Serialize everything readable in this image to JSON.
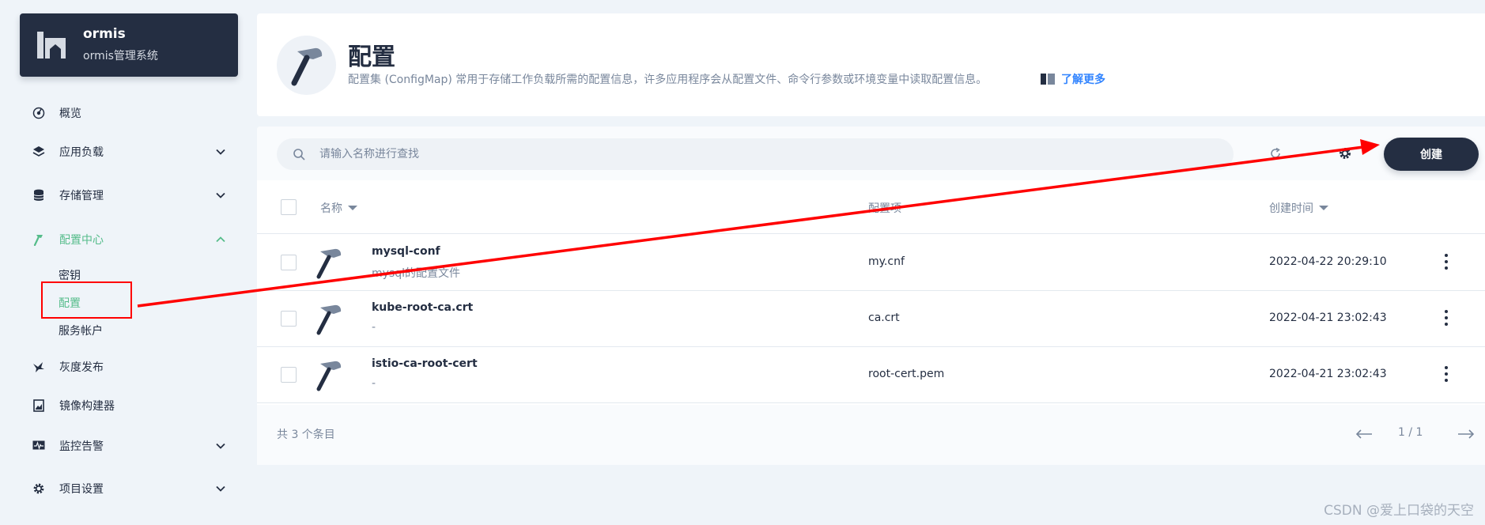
{
  "project": {
    "name": "ormis",
    "description": "ormis管理系统",
    "icon": "project-icon"
  },
  "sidebar": {
    "items": [
      {
        "label": "概览",
        "icon": "dashboard-icon"
      },
      {
        "label": "应用负载",
        "icon": "layers-icon"
      },
      {
        "label": "存储管理",
        "icon": "database-icon"
      },
      {
        "label": "配置中心",
        "icon": "hammer-icon"
      },
      {
        "label": "灰度发布",
        "icon": "bird-icon"
      },
      {
        "label": "镜像构建器",
        "icon": "image-builder-icon"
      },
      {
        "label": "监控告警",
        "icon": "monitor-icon"
      },
      {
        "label": "项目设置",
        "icon": "gear-icon"
      }
    ],
    "config_sub": [
      {
        "label": "密钥"
      },
      {
        "label": "配置"
      },
      {
        "label": "服务帐户"
      }
    ]
  },
  "header": {
    "title": "配置",
    "description": "配置集 (ConfigMap) 常用于存储工作负载所需的配置信息，许多应用程序会从配置文件、命令行参数或环境变量中读取配置信息。",
    "learn_more": "了解更多"
  },
  "toolbar": {
    "search_placeholder": "请输入名称进行查找",
    "create_label": "创建"
  },
  "table": {
    "columns": [
      "名称",
      "配置项",
      "创建时间"
    ],
    "rows": [
      {
        "name": "mysql-conf",
        "description": "mysql的配置文件",
        "items": "my.cnf",
        "created": "2022-04-22 20:29:10"
      },
      {
        "name": "kube-root-ca.crt",
        "description": "-",
        "items": "ca.crt",
        "created": "2022-04-21 23:02:43"
      },
      {
        "name": "istio-ca-root-cert",
        "description": "-",
        "items": "root-cert.pem",
        "created": "2022-04-21 23:02:43"
      }
    ],
    "total": "共 3 个条目",
    "page": "1 / 1"
  },
  "watermark": "CSDN @爱上口袋的天空",
  "colors": {
    "accent": "#55bc8a",
    "dark": "#242e42",
    "annotation": "#ff0000",
    "link": "#3385ff"
  }
}
